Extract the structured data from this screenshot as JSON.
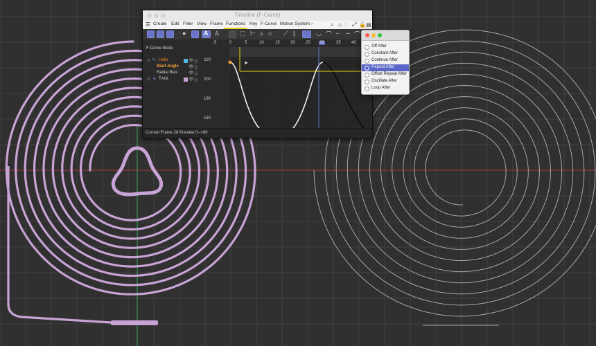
{
  "scene": {
    "background": "#303030",
    "grid_color": "#3f3f3f",
    "axis_x_color": "#a83a3a",
    "axis_y_color": "#3aa55a",
    "helix_color": "#c8a4d6",
    "twist_color": "#a8a8a8"
  },
  "timeline": {
    "title": "Timeline (F-Curve)",
    "menu": [
      "Create",
      "Edit",
      "Filter",
      "View",
      "Frame",
      "Functions",
      "Key",
      "F-Curve",
      "Motion System",
      "›"
    ],
    "active_menu": "Functions",
    "mode_label": "F-Curve Mode",
    "tree": {
      "helix": "Helix",
      "start_angle": "Start Angle",
      "radial_bias": "Radial Bias",
      "twist": "Twist"
    },
    "ruler_ticks": [
      "-5",
      "0",
      "5",
      "10",
      "15",
      "20",
      "25",
      "28",
      "35",
      "40"
    ],
    "value_ticks": [
      "220",
      "200",
      "180",
      "160"
    ],
    "status": "Current Frame  28  Preview  0-->90",
    "current_frame": 28,
    "accent": "#e8d219",
    "selection_color": "#6a75c9"
  },
  "popup": {
    "options": [
      "Off After",
      "Constant After",
      "Continue After",
      "Repeat After",
      "Offset Repeat After",
      "Oscillate After",
      "Loop After"
    ],
    "selected": "Repeat After"
  },
  "icons": [
    "apple-icon",
    "search-icon",
    "home-icon",
    "filter-icon",
    "expand-icon",
    "lock-icon",
    "record-icon",
    "eye-icon",
    "gear-icon"
  ]
}
